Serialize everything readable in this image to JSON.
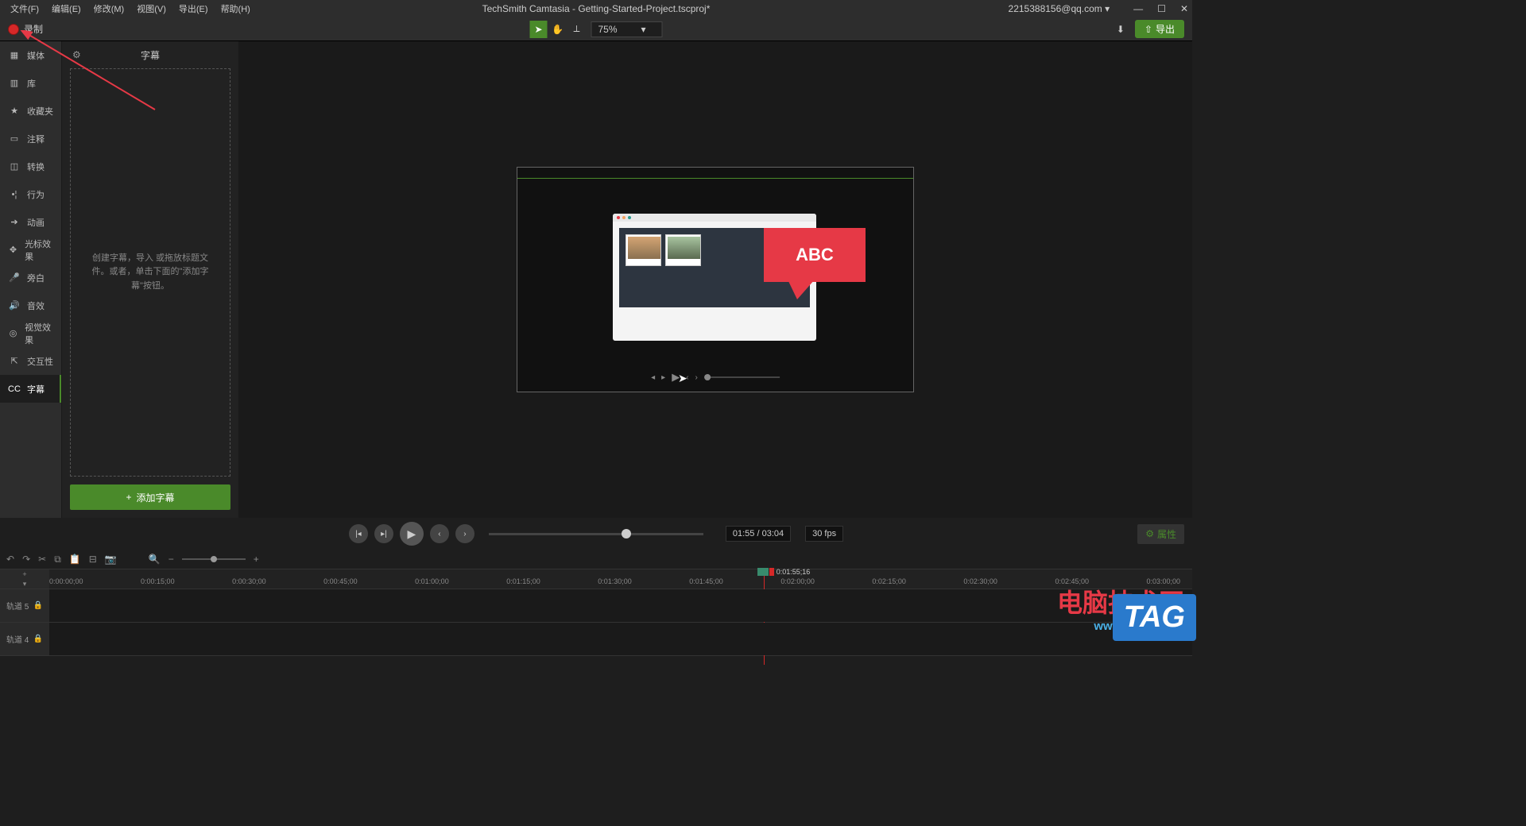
{
  "app_title": "TechSmith Camtasia - Getting-Started-Project.tscproj*",
  "account": "2215388156@qq.com ▾",
  "menus": [
    "文件(F)",
    "编辑(E)",
    "修改(M)",
    "视图(V)",
    "导出(E)",
    "帮助(H)"
  ],
  "record_label": "录制",
  "zoom_value": "75%",
  "export_label": "导出",
  "sidebar": {
    "items": [
      {
        "icon": "▦",
        "label": "媒体"
      },
      {
        "icon": "▥",
        "label": "库"
      },
      {
        "icon": "★",
        "label": "收藏夹"
      },
      {
        "icon": "▭",
        "label": "注释"
      },
      {
        "icon": "◫",
        "label": "转换"
      },
      {
        "icon": "•¦",
        "label": "行为"
      },
      {
        "icon": "➔",
        "label": "动画"
      },
      {
        "icon": "✥",
        "label": "光标效果"
      },
      {
        "icon": "🎤",
        "label": "旁白"
      },
      {
        "icon": "🔊",
        "label": "音效"
      },
      {
        "icon": "◎",
        "label": "视觉效果"
      },
      {
        "icon": "⇱",
        "label": "交互性"
      },
      {
        "icon": "CC",
        "label": "字幕"
      }
    ]
  },
  "panel": {
    "title": "字幕",
    "drop_text": "创建字幕，导入 或拖放标题文件。或者，单击下面的\"添加字幕\"按钮。",
    "add_button": "添加字幕"
  },
  "canvas_callout_text": "ABC",
  "playback": {
    "time": "01:55 / 03:04",
    "fps": "30 fps",
    "properties_label": "属性"
  },
  "timeline": {
    "playhead_time": "0:01:55;16",
    "ticks": [
      "0:00:00;00",
      "0:00:15;00",
      "0:00:30;00",
      "0:00:45;00",
      "0:01:00;00",
      "0:01:15;00",
      "0:01:30;00",
      "0:01:45;00",
      "0:02:00;00",
      "0:02:15;00",
      "0:02:30;00",
      "0:02:45;00",
      "0:03:00;00"
    ],
    "tracks": [
      "轨道 5",
      "轨道 4"
    ]
  },
  "watermark": {
    "text": "电脑技术网",
    "url": "www.tagxp.com",
    "tag": "TAG"
  }
}
